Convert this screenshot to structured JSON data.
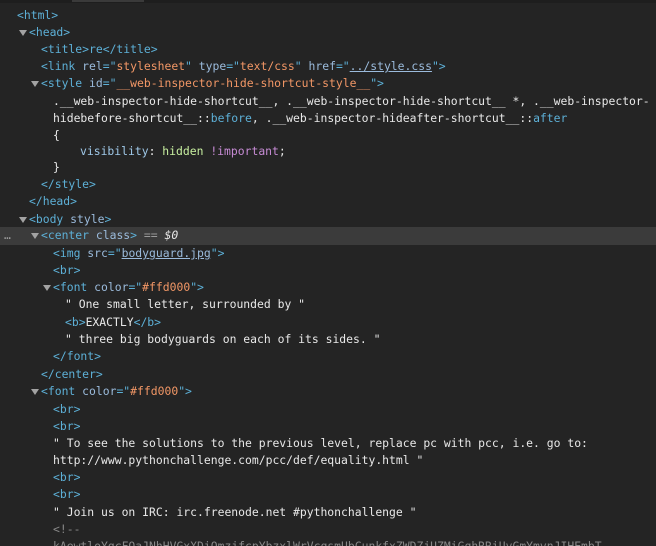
{
  "lines": [
    {
      "t": "<html>"
    },
    {
      "t": "<head>"
    },
    {
      "t": "<title>re</title>"
    },
    {
      "p1": "<link ",
      "a1": "rel",
      "e1": "=\"",
      "v1": "stylesheet",
      "e2": "\" ",
      "a2": "type",
      "e3": "=\"",
      "v2": "text/css",
      "e4": "\" ",
      "a3": "href",
      "e5": "=\"",
      "v3": "../style.css",
      "e6": "\">"
    },
    {
      "p1": "<style ",
      "a1": "id",
      "e1": "=\"",
      "v1": "__web-inspector-hide-shortcut-style__",
      "e2": "\">"
    },
    {
      "t": ".__web-inspector-hide-shortcut__, .__web-inspector-hide-shortcut__ *, .__web-inspector-"
    },
    {
      "t1": "hidebefore-shortcut__::",
      "p": "before",
      "t2": ", .__web-inspector-hideafter-shortcut__::",
      "p2": "after"
    },
    {
      "t": "{"
    },
    {
      "prop": "visibility",
      "colon": ": ",
      "kw": "hidden",
      "sp": " ",
      "imp": "!important",
      "semi": ";"
    },
    {
      "t": "}"
    },
    {
      "t": "</style>"
    },
    {
      "t": "</head>"
    },
    {
      "t": "<body ",
      "a": "style",
      "t2": ">"
    },
    {
      "dots": "…",
      "t": "<center ",
      "a": "class",
      "t2": ">",
      "eq": " == ",
      "d": "$0"
    },
    {
      "p1": "<img ",
      "a1": "src",
      "e1": "=\"",
      "v1": "bodyguard.jpg",
      "e2": "\">"
    },
    {
      "t": "<br>"
    },
    {
      "p1": "<font ",
      "a1": "color",
      "e1": "=\"",
      "v1": "#ffd000",
      "e2": "\">"
    },
    {
      "t": "\" One small letter, surrounded by \""
    },
    {
      "t1": "<b>",
      "t": "EXACTLY",
      "t2": "</b>"
    },
    {
      "t": "\" three big bodyguards on each of its sides. \""
    },
    {
      "t": "</font>"
    },
    {
      "t": "</center>"
    },
    {
      "p1": "<font ",
      "a1": "color",
      "e1": "=\"",
      "v1": "#ffd000",
      "e2": "\">"
    },
    {
      "t": "<br>"
    },
    {
      "t": "<br>"
    },
    {
      "t": "\" To see the solutions to the previous level, replace pc with pcc, i.e. go to:"
    },
    {
      "t": "http://www.pythonchallenge.com/pcc/def/equality.html \""
    },
    {
      "t": "<br>"
    },
    {
      "t": "<br>"
    },
    {
      "t": "\" Join us on IRC: irc.freenode.net #pythonchallenge \""
    },
    {
      "t": "<!--"
    },
    {
      "t": "kAewtloYgcFQaJNhHVGxXDiQmzjfcpYbzxlWrVcqsmUbCunkfxZWDZjUZMiGqhRRiUvGmYmvnJIHEmbT"
    }
  ],
  "colors": {
    "background": "#242424",
    "selected_row": "#3b3b3b",
    "tag": "#5db0d7",
    "attribute_value": "#f29766",
    "property_keyword": "#c8f0a0",
    "important": "#c68bd4"
  }
}
